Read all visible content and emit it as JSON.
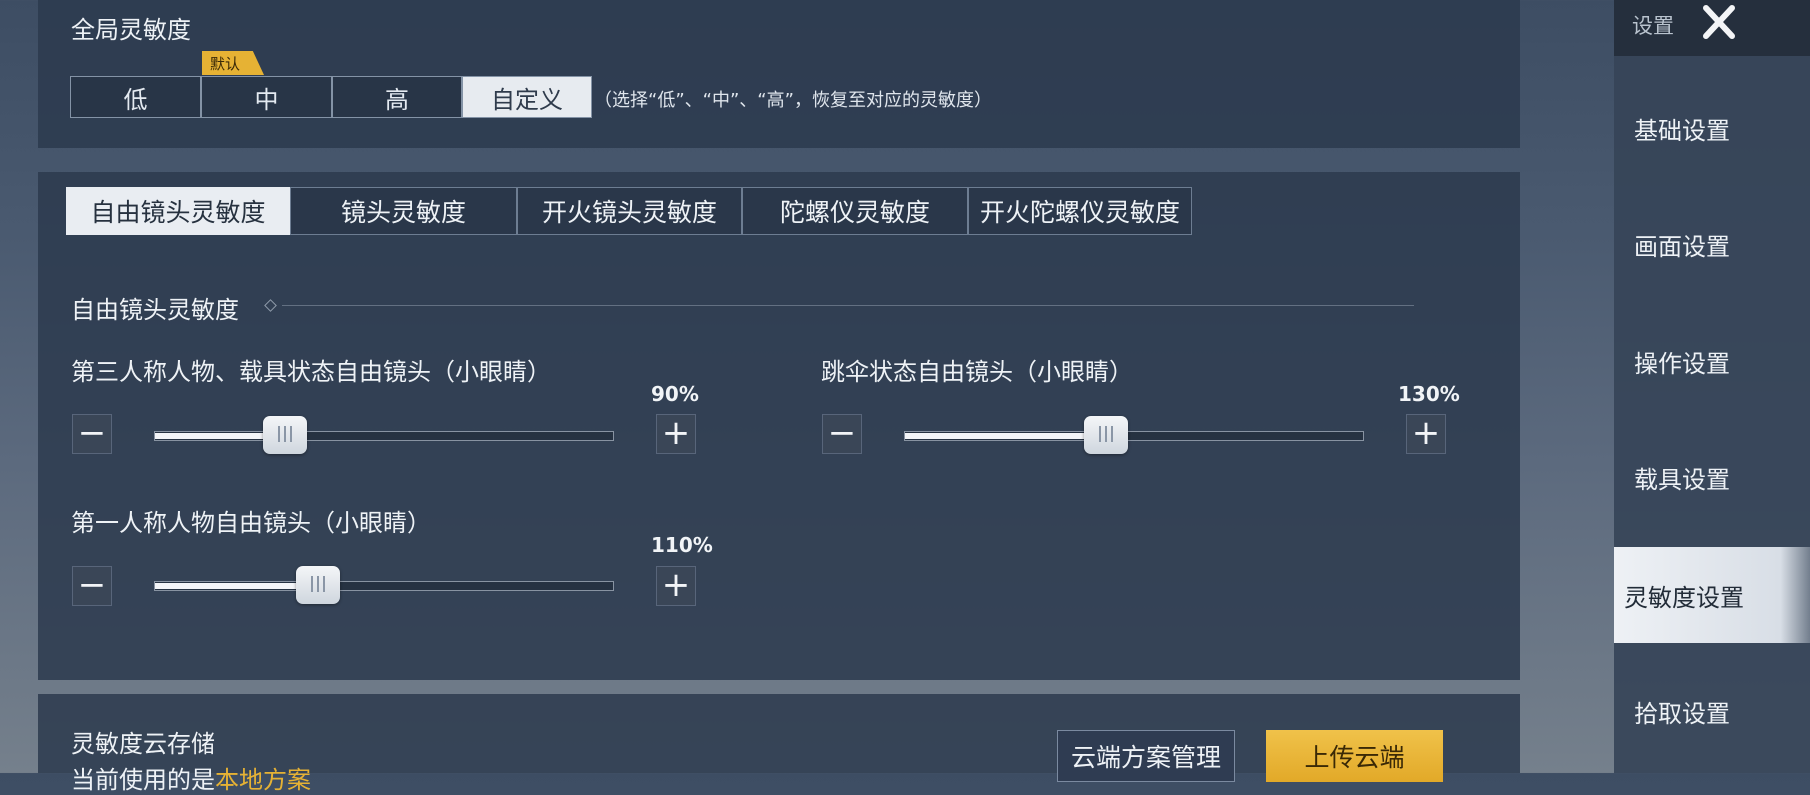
{
  "global": {
    "title": "全局灵敏度",
    "badge": "默认",
    "options": [
      "低",
      "中",
      "高",
      "自定义"
    ],
    "selected": "自定义",
    "hint": "（选择“低”、“中”、“高”，恢复至对应的灵敏度）"
  },
  "tabs": [
    "自由镜头灵敏度",
    "镜头灵敏度",
    "开火镜头灵敏度",
    "陀螺仪灵敏度",
    "开火陀螺仪灵敏度"
  ],
  "section_title": "自由镜头灵敏度",
  "sliders": [
    {
      "label": "第三人称人物、载具状态自由镜头（小眼睛）",
      "value_text": "90%",
      "fraction": 0.26
    },
    {
      "label": "跳伞状态自由镜头（小眼睛）",
      "value_text": "130%",
      "fraction": 0.43
    },
    {
      "label": "第一人称人物自由镜头（小眼睛）",
      "value_text": "110%",
      "fraction": 0.34
    }
  ],
  "cloud": {
    "title": "灵敏度云存储",
    "manage_label": "云端方案管理",
    "upload_label": "上传云端",
    "current_prefix": "当前使用的是",
    "current_value": "本地方案"
  },
  "sidebar": {
    "title": "设置",
    "close_icon": "close-icon",
    "items": [
      "基础设置",
      "画面设置",
      "操作设置",
      "载具设置",
      "灵敏度设置",
      "拾取设置"
    ],
    "selected": "灵敏度设置"
  },
  "colors": {
    "accent": "#e6b234",
    "selected_bg": "#e9edf2"
  }
}
